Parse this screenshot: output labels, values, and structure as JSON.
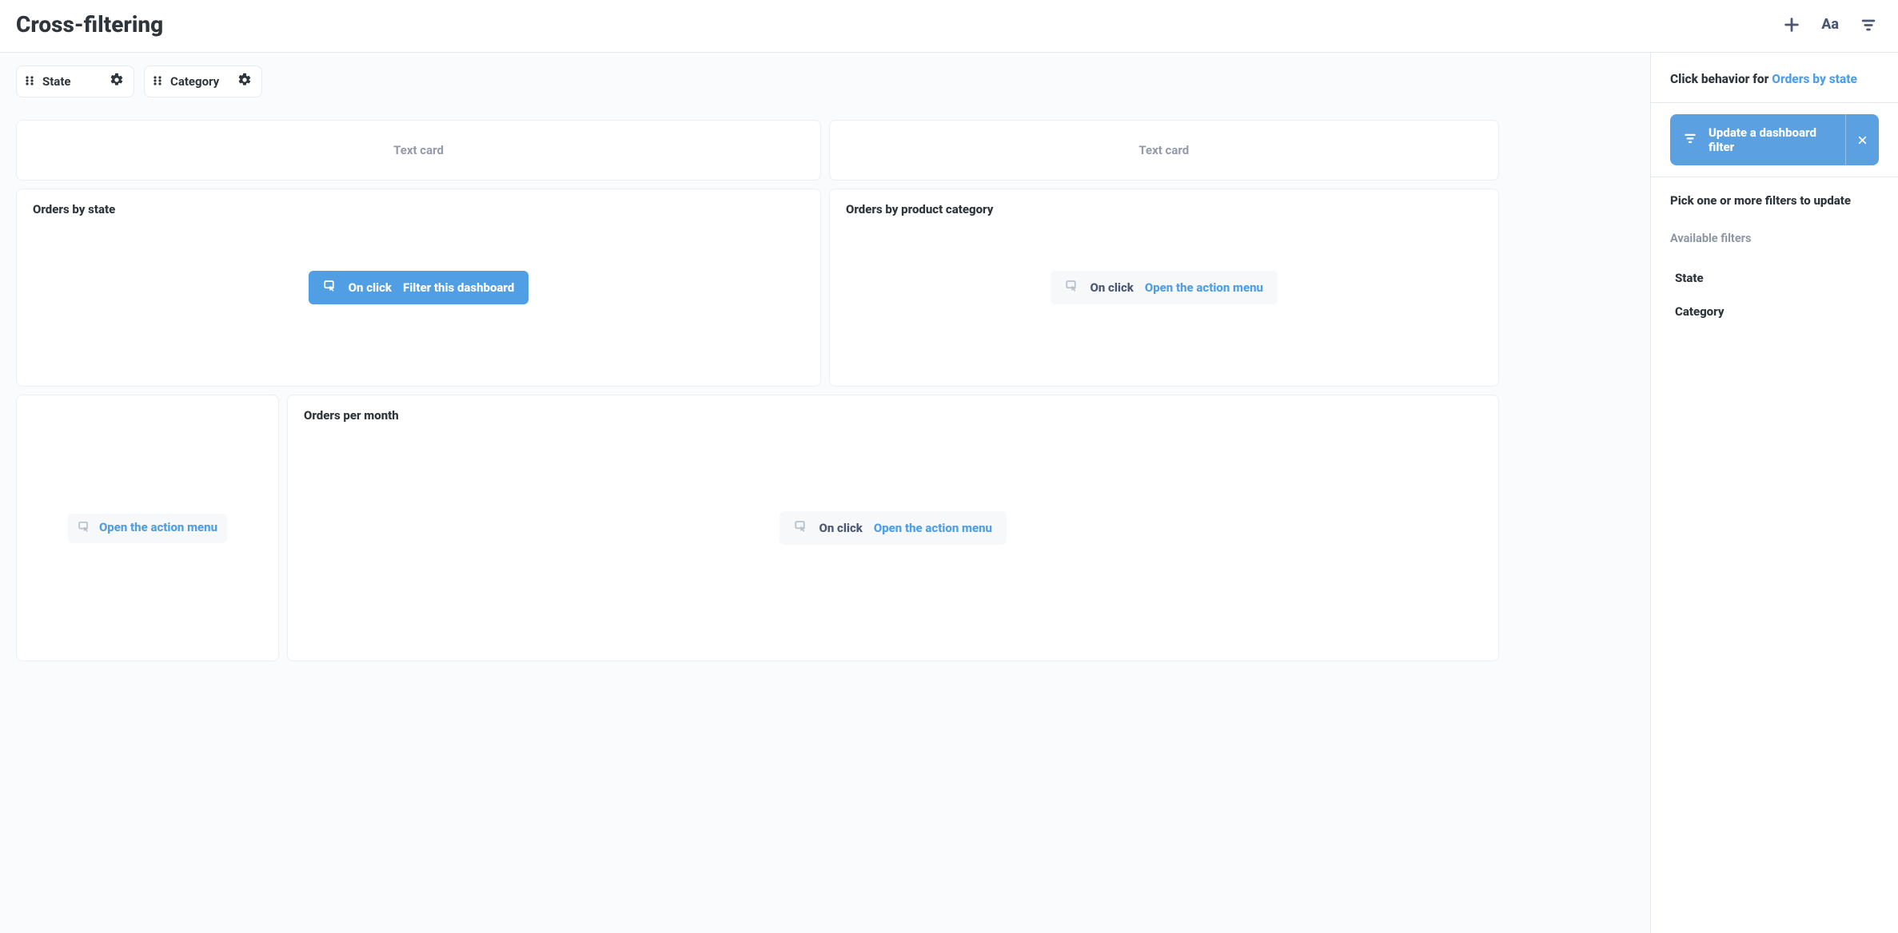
{
  "header": {
    "title": "Cross-filtering"
  },
  "filters": [
    {
      "id": "state",
      "label": "State"
    },
    {
      "id": "category",
      "label": "Category"
    }
  ],
  "cards": {
    "text_card_label": "Text card",
    "orders_by_state": {
      "title": "Orders by state",
      "on_click": "On click",
      "action": "Filter this dashboard",
      "active": true
    },
    "orders_by_product_category": {
      "title": "Orders by product category",
      "on_click": "On click",
      "action": "Open the action menu",
      "active": false
    },
    "small_card": {
      "action": "Open the action menu"
    },
    "orders_per_month": {
      "title": "Orders per month",
      "on_click": "On click",
      "action": "Open the action menu",
      "active": false
    }
  },
  "sidebar": {
    "click_behavior_prefix": "Click behavior for ",
    "click_behavior_target": "Orders by state",
    "update_filter_label": "Update a dashboard filter",
    "pick_filters_heading": "Pick one or more filters to update",
    "available_filters_label": "Available filters",
    "available_filters": [
      {
        "id": "state",
        "label": "State"
      },
      {
        "id": "category",
        "label": "Category"
      }
    ]
  }
}
